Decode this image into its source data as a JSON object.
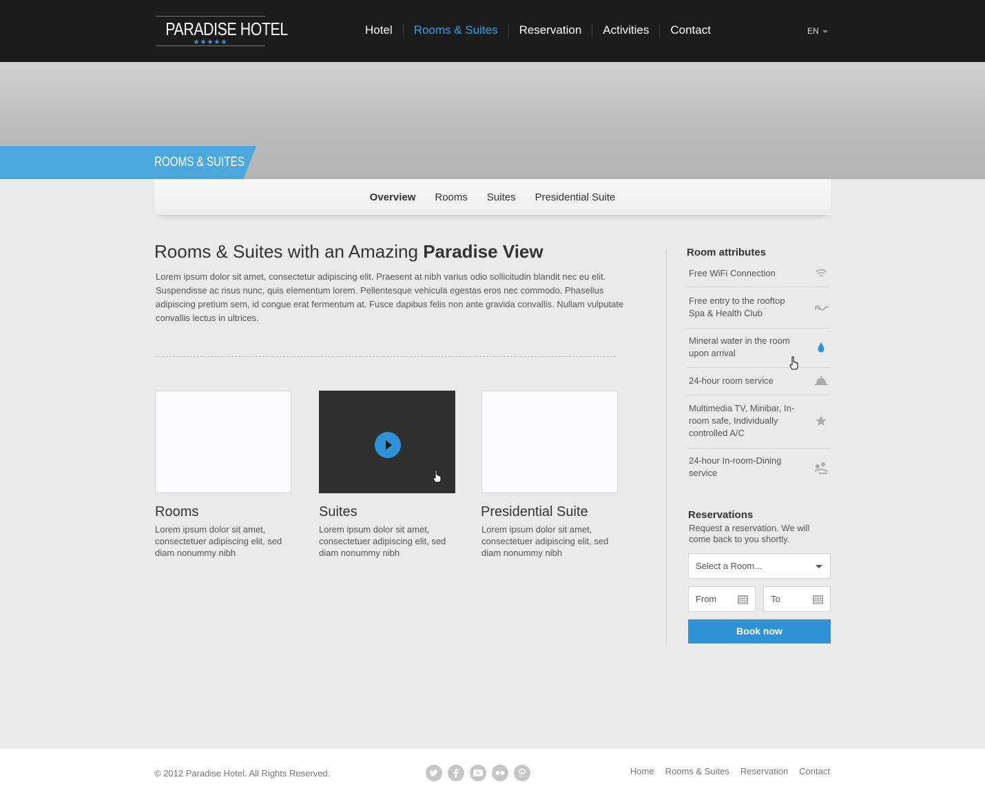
{
  "header": {
    "logo_text": "PARADISE HOTEL",
    "logo_stars": "★★★★★",
    "nav": [
      {
        "label": "Hotel",
        "active": false
      },
      {
        "label": "Rooms & Suites",
        "active": true
      },
      {
        "label": "Reservation",
        "active": false
      },
      {
        "label": "Activities",
        "active": false
      },
      {
        "label": "Contact",
        "active": false
      }
    ],
    "language": "EN"
  },
  "hero": {
    "banner_label": "ROOMS & SUITES"
  },
  "subnav": {
    "items": [
      {
        "label": "Overview",
        "active": true
      },
      {
        "label": "Rooms",
        "active": false
      },
      {
        "label": "Suites",
        "active": false
      },
      {
        "label": "Presidential Suite",
        "active": false
      }
    ]
  },
  "main": {
    "title_regular": "Rooms & Suites with an Amazing ",
    "title_bold": "Paradise View",
    "intro": "Lorem ipsum dolor sit amet, consectetur adipiscing elit. Praesent at nibh varius odio sollicitudin blandit nec eu elit. Suspendisse ac risus nunc, quis elementum lorem. Pellentesque vehicula egestas eros nec commodo. Phasellus adipiscing pretium sem, id congue erat fermentum at. Fusce dapibus felis non ante gravida convallis. Nullam vulputate convallis lectus in ultrices.",
    "cards": [
      {
        "title": "Rooms",
        "text": "Lorem ipsum dolor sit amet, consectetuer adipiscing elit, sed diam nonummy nibh"
      },
      {
        "title": "Suites",
        "text": "Lorem ipsum dolor sit amet, consectetuer adipiscing elit, sed diam nonummy nibh"
      },
      {
        "title": "Presidential Suite",
        "text": "Lorem ipsum dolor sit amet, consectetuer adipiscing elit, sed diam nonummy nibh"
      }
    ]
  },
  "sidebar": {
    "attributes_heading": "Room attributes",
    "attributes": [
      {
        "label": "Free WiFi Connection",
        "icon": "wifi-icon"
      },
      {
        "label": "Free entry to the rooftop Spa & Health Club",
        "icon": "spa-icon"
      },
      {
        "label": "Mineral water in the room upon arrival",
        "icon": "water-drop-icon"
      },
      {
        "label": "24-hour room service",
        "icon": "service-bell-icon"
      },
      {
        "label": "Multimedia TV, Minibar, In-room safe, Individually controlled A/C",
        "icon": "star-icon"
      },
      {
        "label": "24-hour In-room-Dining service",
        "icon": "dining-icon"
      }
    ],
    "reservations": {
      "heading": "Reservations",
      "subtitle": "Request a reservation. We will come back to you shortly.",
      "room_select": "Select a Room...",
      "from_placeholder": "From",
      "to_placeholder": "To",
      "book_label": "Book now"
    }
  },
  "footer": {
    "copyright": "© 2012 Paradise Hotel. All Rights Reserved.",
    "socials": [
      "twitter-icon",
      "facebook-icon",
      "youtube-icon",
      "flickr-icon",
      "pinterest-icon"
    ],
    "links": [
      "Home",
      "Rooms & Suites",
      "Reservation",
      "Contact"
    ]
  },
  "colors": {
    "accent": "#2d93d6",
    "banner": "#4aa8dc",
    "header_bg": "#1c1c1c",
    "page_bg": "#eaeaea"
  }
}
